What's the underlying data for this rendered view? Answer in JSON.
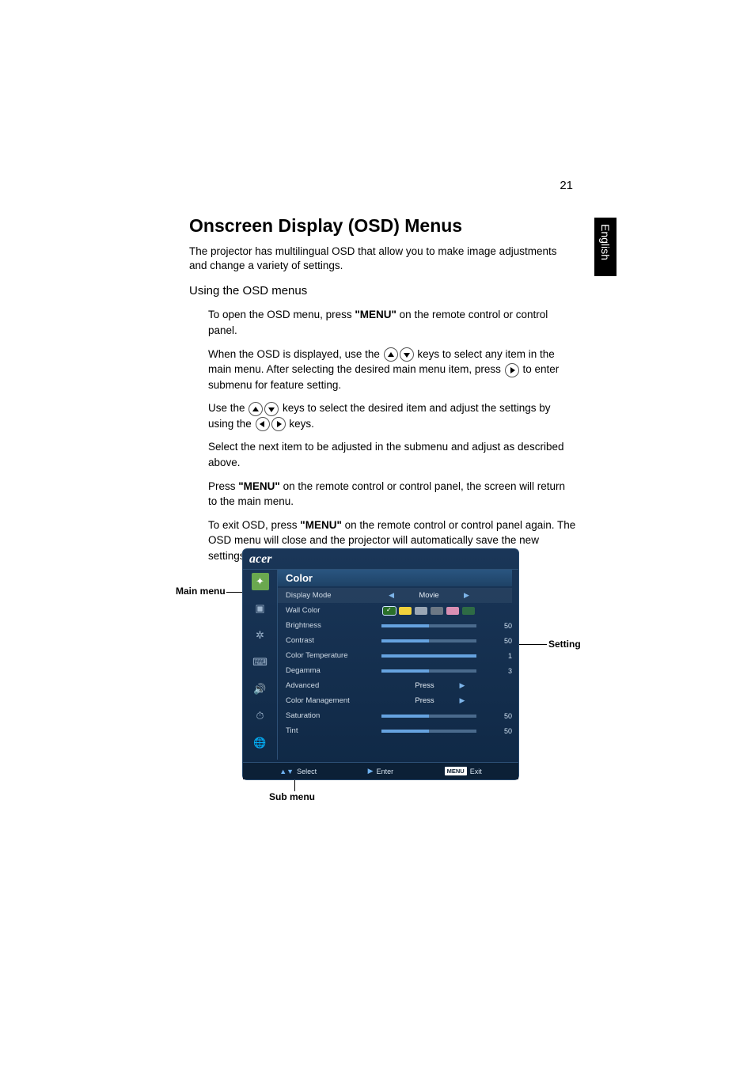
{
  "page_number": "21",
  "lang_tab": "English",
  "heading": "Onscreen Display (OSD) Menus",
  "intro": "The projector has multilingual OSD that allow you to make image adjustments and change a variety of settings.",
  "subheading": "Using the OSD menus",
  "bullets": {
    "b1a": "To open the OSD menu, press ",
    "b1b": "\"MENU\"",
    "b1c": " on the remote control or control panel.",
    "b2a": "When the OSD is displayed, use the ",
    "b2b": " keys to select any item in the main menu. After selecting the desired main menu item, press ",
    "b2c": " to enter submenu for feature setting.",
    "b3a": "Use the ",
    "b3b": " keys to select the desired item and adjust the settings by using the ",
    "b3c": " keys.",
    "b4": "Select the next item to be adjusted in the submenu and adjust as described above.",
    "b5a": "Press ",
    "b5b": "\"MENU\"",
    "b5c": " on the remote control or control panel, the screen will return to the main menu.",
    "b6a": "To exit OSD, press ",
    "b6b": "\"MENU\"",
    "b6c": " on the remote control or control panel again. The OSD menu will close and the projector will automatically save the new settings."
  },
  "callouts": {
    "main_menu": "Main menu",
    "setting": "Setting",
    "sub_menu": "Sub menu"
  },
  "osd": {
    "brand": "acer",
    "menu_title": "Color",
    "footer": {
      "select": "Select",
      "enter": "Enter",
      "menu": "MENU",
      "exit": "Exit"
    },
    "rows": [
      {
        "label": "Display Mode",
        "type": "lr",
        "value": "Movie"
      },
      {
        "label": "Wall Color",
        "type": "swatch"
      },
      {
        "label": "Brightness",
        "type": "slider",
        "value": "50",
        "pct": 50
      },
      {
        "label": "Contrast",
        "type": "slider",
        "value": "50",
        "pct": 50
      },
      {
        "label": "Color Temperature",
        "type": "slider",
        "value": "1",
        "pct": 100
      },
      {
        "label": "Degamma",
        "type": "slider",
        "value": "3",
        "pct": 50
      },
      {
        "label": "Advanced",
        "type": "press",
        "value": "Press"
      },
      {
        "label": "Color Management",
        "type": "press",
        "value": "Press"
      },
      {
        "label": "Saturation",
        "type": "slider",
        "value": "50",
        "pct": 50
      },
      {
        "label": "Tint",
        "type": "slider",
        "value": "50",
        "pct": 50
      }
    ],
    "swatches": [
      "#2a6f2a",
      "#f2d23c",
      "#9aa7b5",
      "#6c7885",
      "#d98fb3",
      "#2e6b45"
    ]
  }
}
